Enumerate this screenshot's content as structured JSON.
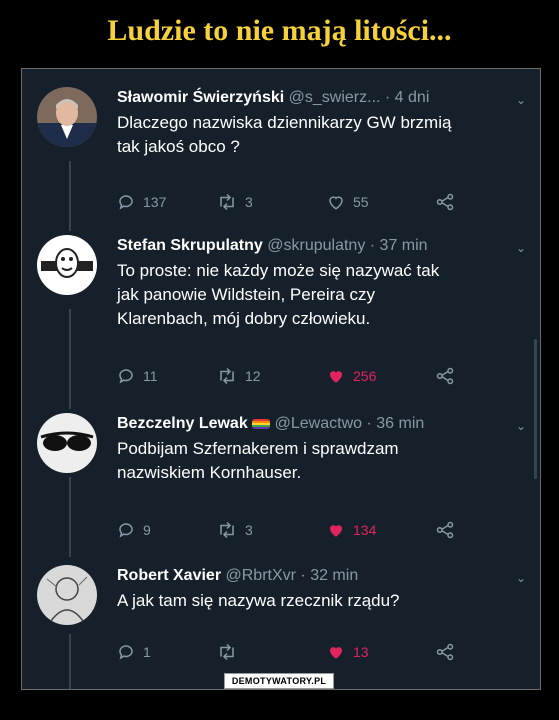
{
  "page": {
    "title": "Ludzie to nie mają litości..."
  },
  "tweets": [
    {
      "name": "Sławomir Świerzyński",
      "handle": "@s_swierz...",
      "sep": " · ",
      "time": "4 dni",
      "text_lines": [
        "Dlaczego nazwiska dziennikarzy GW brzmią",
        "tak jakoś obco ?"
      ],
      "replies": "137",
      "retweets": "3",
      "likes": "55",
      "liked": false,
      "avatar_icon": "portrait-man-icon"
    },
    {
      "name": "Stefan Skrupulatny",
      "handle": "@skrupulatny",
      "sep": " · ",
      "time": "37 min",
      "text_lines": [
        "To proste: nie każdy może się nazywać tak",
        "jak panowie Wildstein, Pereira czy",
        "Klarenbach, mój dobry człowieku."
      ],
      "replies": "11",
      "retweets": "12",
      "likes": "256",
      "liked": true,
      "avatar_icon": "cartoon-logo-icon"
    },
    {
      "name": "Bezczelny Lewak",
      "handle": "@Lewactwo",
      "sep": " · ",
      "time": "36 min",
      "text_lines": [
        "Podbijam Szfernakerem i sprawdzam",
        "nazwiskiem Kornhauser."
      ],
      "replies": "9",
      "retweets": "3",
      "likes": "134",
      "liked": true,
      "avatar_icon": "sunglasses-icon"
    },
    {
      "name": "Robert Xavier",
      "handle": "@RbrtXvr",
      "sep": " · ",
      "time": "32 min",
      "text_lines": [
        "A jak tam się nazywa rzecznik rządu?"
      ],
      "replies": "1",
      "retweets": "",
      "likes": "13",
      "liked": true,
      "avatar_icon": "sketch-drawing-icon"
    }
  ],
  "watermark": "DEMOTYWATORY.PL",
  "colors": {
    "title": "#f5d23a",
    "background": "#15202b",
    "text": "#ffffff",
    "muted": "#8899a6",
    "like": "#e0245e"
  }
}
